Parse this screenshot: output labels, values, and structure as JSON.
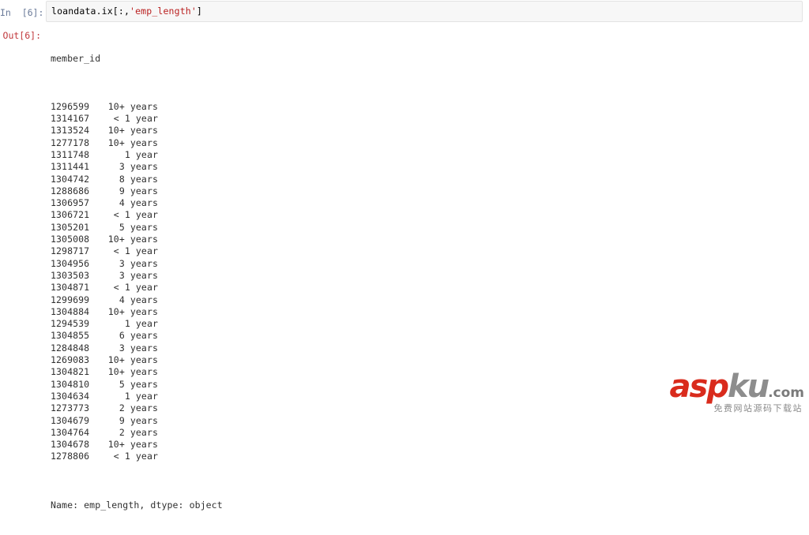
{
  "cell": {
    "input_prompt": "In  [6]:",
    "output_prompt": "Out[6]:",
    "code_before_string": "loandata.ix[:,",
    "code_string_literal": "'emp_length'",
    "code_after_string": "]",
    "code_full": "loandata.ix[:,'emp_length']"
  },
  "output": {
    "index_name": "member_id",
    "footer": "Name: emp_length, dtype: object",
    "rows": [
      {
        "member_id": "1296599",
        "emp_length": "10+ years"
      },
      {
        "member_id": "1314167",
        "emp_length": "< 1 year"
      },
      {
        "member_id": "1313524",
        "emp_length": "10+ years"
      },
      {
        "member_id": "1277178",
        "emp_length": "10+ years"
      },
      {
        "member_id": "1311748",
        "emp_length": "1 year"
      },
      {
        "member_id": "1311441",
        "emp_length": "3 years"
      },
      {
        "member_id": "1304742",
        "emp_length": "8 years"
      },
      {
        "member_id": "1288686",
        "emp_length": "9 years"
      },
      {
        "member_id": "1306957",
        "emp_length": "4 years"
      },
      {
        "member_id": "1306721",
        "emp_length": "< 1 year"
      },
      {
        "member_id": "1305201",
        "emp_length": "5 years"
      },
      {
        "member_id": "1305008",
        "emp_length": "10+ years"
      },
      {
        "member_id": "1298717",
        "emp_length": "< 1 year"
      },
      {
        "member_id": "1304956",
        "emp_length": "3 years"
      },
      {
        "member_id": "1303503",
        "emp_length": "3 years"
      },
      {
        "member_id": "1304871",
        "emp_length": "< 1 year"
      },
      {
        "member_id": "1299699",
        "emp_length": "4 years"
      },
      {
        "member_id": "1304884",
        "emp_length": "10+ years"
      },
      {
        "member_id": "1294539",
        "emp_length": "1 year"
      },
      {
        "member_id": "1304855",
        "emp_length": "6 years"
      },
      {
        "member_id": "1284848",
        "emp_length": "3 years"
      },
      {
        "member_id": "1269083",
        "emp_length": "10+ years"
      },
      {
        "member_id": "1304821",
        "emp_length": "10+ years"
      },
      {
        "member_id": "1304810",
        "emp_length": "5 years"
      },
      {
        "member_id": "1304634",
        "emp_length": "1 year"
      },
      {
        "member_id": "1273773",
        "emp_length": "2 years"
      },
      {
        "member_id": "1304679",
        "emp_length": "9 years"
      },
      {
        "member_id": "1304764",
        "emp_length": "2 years"
      },
      {
        "member_id": "1304678",
        "emp_length": "10+ years"
      },
      {
        "member_id": "1278806",
        "emp_length": "< 1 year"
      }
    ]
  },
  "watermark": {
    "part_asp": "asp",
    "part_ku": "ku",
    "part_com": ".com",
    "subtitle": "免费网站源码下载站"
  },
  "colors": {
    "string_literal": "#ba2121",
    "in_prompt": "#6a7a99",
    "out_prompt": "#c1393d",
    "output_text": "#303030",
    "input_cell_bg": "#f7f7f7",
    "input_cell_border": "#e3e3e3",
    "watermark_red": "#d92b1c",
    "watermark_gray": "#8d8d8d",
    "page_bg": "#ffffff"
  }
}
